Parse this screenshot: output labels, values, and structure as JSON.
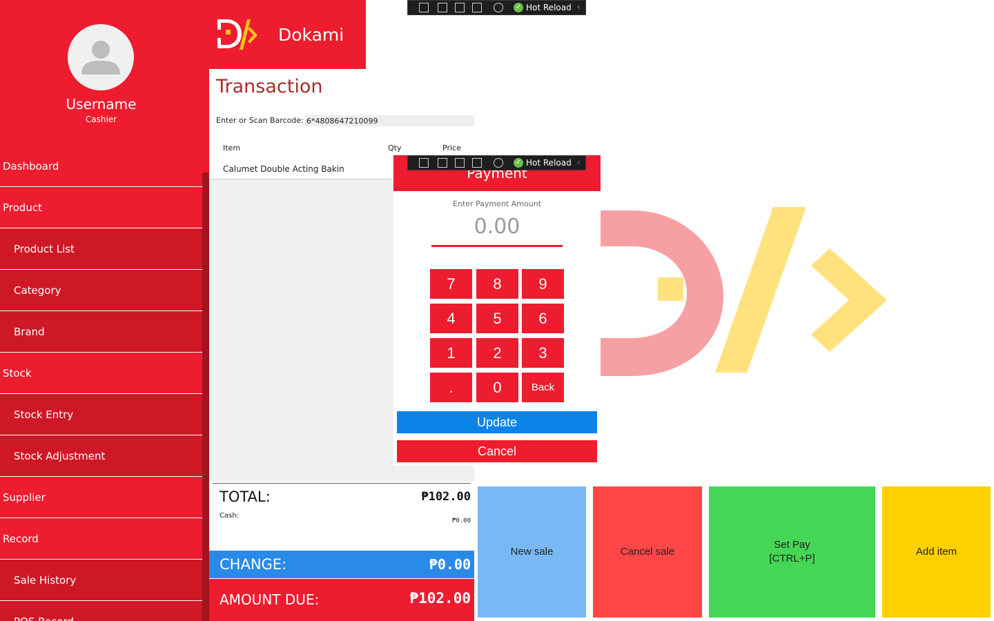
{
  "sidebar": {
    "username": "Username",
    "role": "Cashier",
    "items": [
      {
        "label": "Dashboard"
      },
      {
        "label": "Product"
      },
      {
        "label": "Product List"
      },
      {
        "label": "Category"
      },
      {
        "label": "Brand"
      },
      {
        "label": "Stock"
      },
      {
        "label": "Stock Entry"
      },
      {
        "label": "Stock Adjustment"
      },
      {
        "label": "Supplier"
      },
      {
        "label": "Record"
      },
      {
        "label": "Sale History"
      },
      {
        "label": "POS Record"
      }
    ]
  },
  "header": {
    "app_name": "Dokami"
  },
  "devtools": {
    "hot_reload": "Hot Reload"
  },
  "transaction": {
    "title": "Transaction",
    "barcode_label": "Enter or Scan Barcode:",
    "barcode_value": "6*4808647210099",
    "columns": {
      "item": "Item",
      "qty": "Qty",
      "price": "Price"
    },
    "rows": [
      {
        "item": "Calumet Double Acting Bakin"
      }
    ]
  },
  "totals": {
    "total_label": "TOTAL:",
    "total_value": "₱102.00",
    "cash_label": "Cash:",
    "cash_value": "₱0.00",
    "change_label": "CHANGE:",
    "change_value": "₱0.00",
    "due_label": "AMOUNT DUE:",
    "due_value": "₱102.00"
  },
  "actions": {
    "new_sale": "New sale",
    "cancel_sale": "Cancel sale",
    "set_pay": "Set Pay\n[CTRL+P]",
    "add_item": "Add item"
  },
  "payment": {
    "title": "Payment",
    "subtitle": "Enter Payment Amount",
    "amount": "0.00",
    "keys": [
      "7",
      "8",
      "9",
      "4",
      "5",
      "6",
      "1",
      "2",
      "3",
      ".",
      "0",
      "Back"
    ],
    "update_label": "Update",
    "cancel_label": "Cancel"
  },
  "colors": {
    "brand_red": "#ed1c2e",
    "sub_red": "#ce1826",
    "blue": "#2a8ae8",
    "tile_blue": "#7ab8f5",
    "tile_red": "#ff4747",
    "tile_green": "#45d655",
    "tile_yellow": "#ffd000",
    "logo_yellow": "#f7c21b"
  }
}
